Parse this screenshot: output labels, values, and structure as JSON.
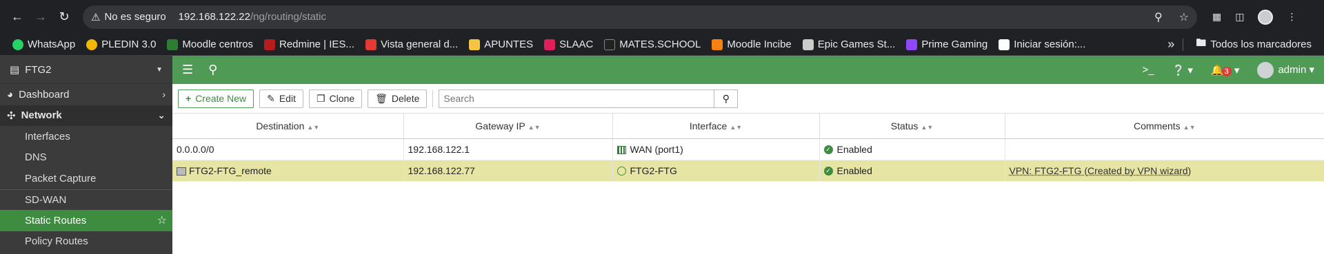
{
  "browser": {
    "security_label": "No es seguro",
    "url_host": "192.168.122.22",
    "url_path": "/ng/routing/static",
    "bookmarks": [
      {
        "label": "WhatsApp",
        "color": "#25d366"
      },
      {
        "label": "PLEDIN 3.0",
        "color": "#f2b705"
      },
      {
        "label": "Moodle centros",
        "color": "#2e7d32"
      },
      {
        "label": "Redmine | IES...",
        "color": "#b71c1c"
      },
      {
        "label": "Vista general d...",
        "color": "#e53935"
      },
      {
        "label": "APUNTES",
        "color": "#f5c542"
      },
      {
        "label": "SLAAC",
        "color": "#e01e5a"
      },
      {
        "label": "MATES.SCHOOL",
        "color": "#222222"
      },
      {
        "label": "Moodle Incibe",
        "color": "#f98012"
      },
      {
        "label": "Epic Games St...",
        "color": "#cccccc"
      },
      {
        "label": "Prime Gaming",
        "color": "#9146ff"
      },
      {
        "label": "Iniciar sesión:...",
        "color": "#ffffff"
      }
    ],
    "bookmarks_folder": "Todos los marcadores"
  },
  "sidebar": {
    "device": "FTG2",
    "items": [
      {
        "label": "Dashboard"
      },
      {
        "label": "Network"
      }
    ],
    "sub_items": [
      {
        "label": "Interfaces"
      },
      {
        "label": "DNS"
      },
      {
        "label": "Packet Capture"
      },
      {
        "label": "SD-WAN"
      },
      {
        "label": "Static Routes"
      },
      {
        "label": "Policy Routes"
      }
    ]
  },
  "topbar": {
    "notification_count": "3",
    "user": "admin"
  },
  "toolbar": {
    "create_label": "Create New",
    "edit_label": "Edit",
    "clone_label": "Clone",
    "delete_label": "Delete",
    "search_placeholder": "Search"
  },
  "table": {
    "columns": [
      "Destination",
      "Gateway IP",
      "Interface",
      "Status",
      "Comments"
    ],
    "rows": [
      {
        "destination": "0.0.0.0/0",
        "gateway": "192.168.122.1",
        "interface": "WAN (port1)",
        "status": "Enabled",
        "comments": ""
      },
      {
        "destination": "FTG2-FTG_remote",
        "gateway": "192.168.122.77",
        "interface": "FTG2-FTG",
        "status": "Enabled",
        "comments": "VPN: FTG2-FTG (Created by VPN wizard)"
      }
    ]
  }
}
